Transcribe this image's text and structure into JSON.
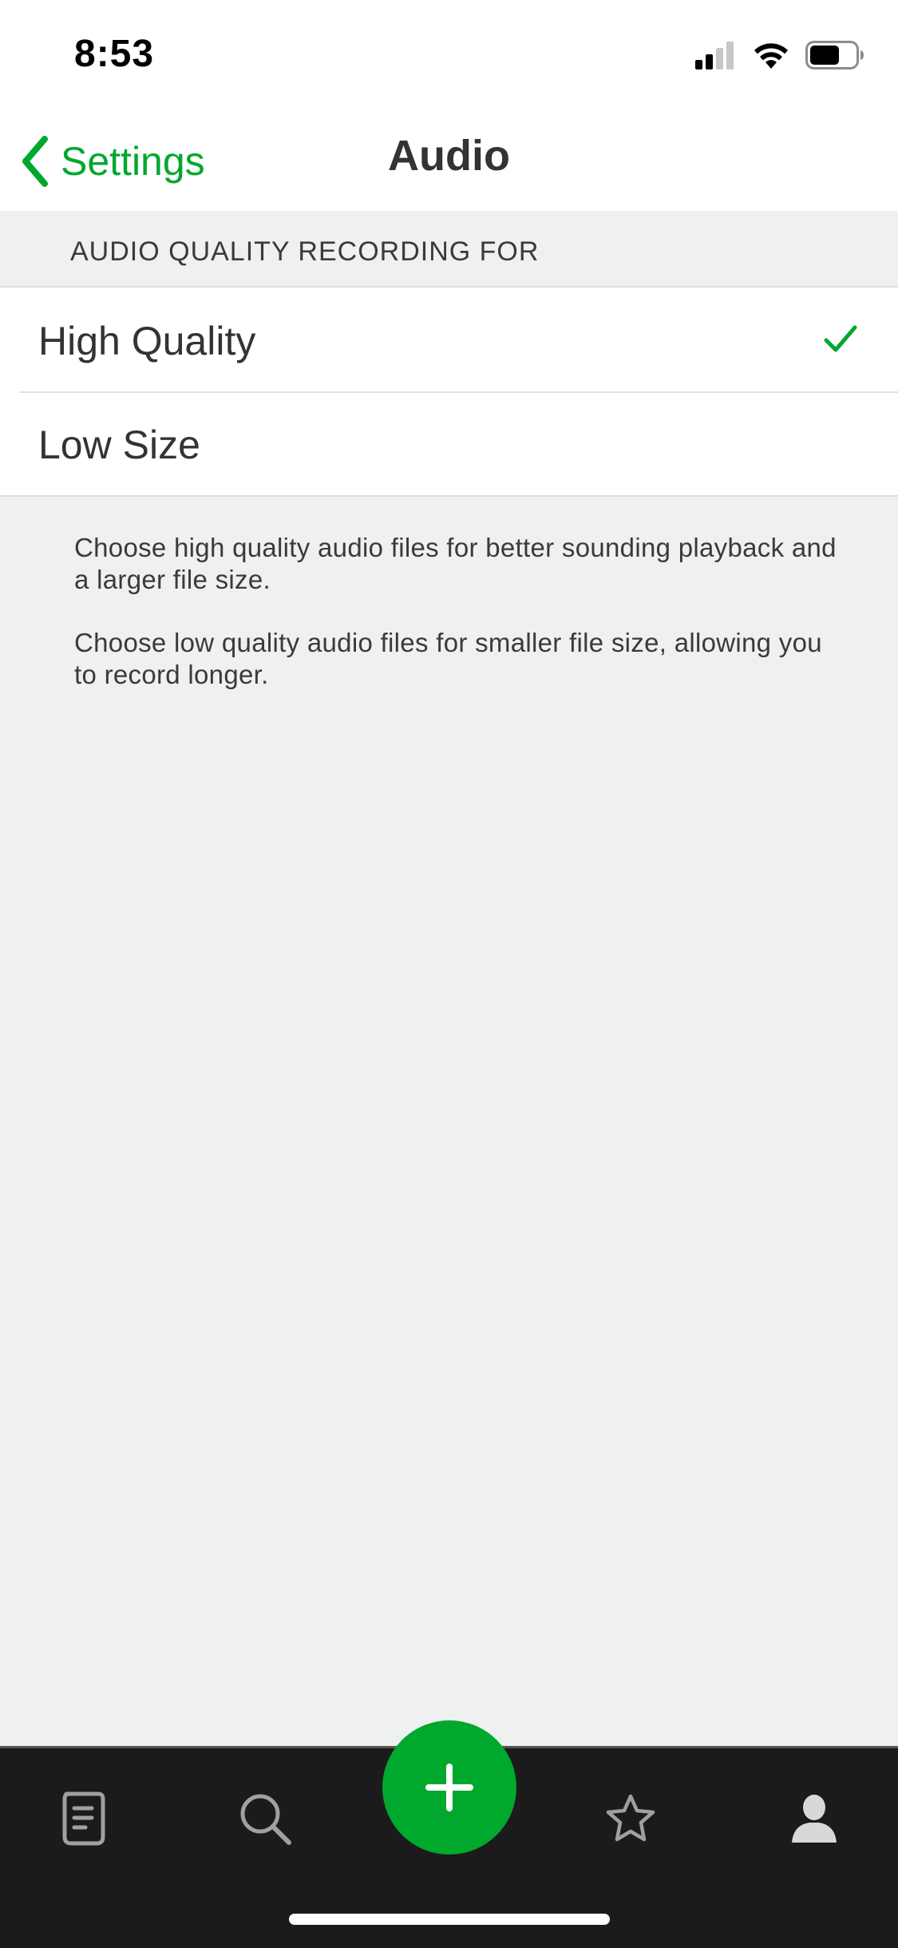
{
  "status": {
    "time": "8:53"
  },
  "nav": {
    "back_label": "Settings",
    "title": "Audio"
  },
  "section": {
    "header": "AUDIO QUALITY RECORDING FOR"
  },
  "options": [
    {
      "label": "High Quality",
      "selected": true
    },
    {
      "label": "Low Size",
      "selected": false
    }
  ],
  "footnote": {
    "high": "Choose high quality audio files for better sounding playback and a larger file size.",
    "low": "Choose low quality audio files for smaller file size, allowing you to record longer."
  },
  "tabbar": {
    "tabs": [
      {
        "icon": "note-icon"
      },
      {
        "icon": "search-icon"
      },
      {
        "icon": "plus-icon"
      },
      {
        "icon": "star-icon"
      },
      {
        "icon": "account-icon"
      }
    ]
  },
  "colors": {
    "accent": "#00a82d",
    "background": "#eff0f0",
    "tabbar": "#1b1b1c"
  }
}
